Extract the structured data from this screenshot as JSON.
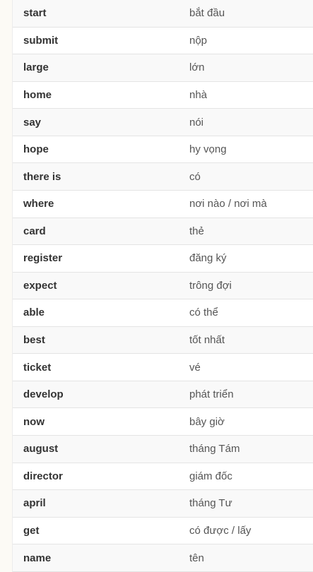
{
  "vocab": {
    "rows": [
      {
        "english": "start",
        "vietnamese": "bắt đầu"
      },
      {
        "english": "submit",
        "vietnamese": "nộp"
      },
      {
        "english": "large",
        "vietnamese": "lớn"
      },
      {
        "english": "home",
        "vietnamese": "nhà"
      },
      {
        "english": "say",
        "vietnamese": "nói"
      },
      {
        "english": "hope",
        "vietnamese": "hy vọng"
      },
      {
        "english": "there is",
        "vietnamese": "có"
      },
      {
        "english": "where",
        "vietnamese": "nơi nào / nơi mà"
      },
      {
        "english": "card",
        "vietnamese": "thẻ"
      },
      {
        "english": "register",
        "vietnamese": "đăng ký"
      },
      {
        "english": "expect",
        "vietnamese": "trông đợi"
      },
      {
        "english": "able",
        "vietnamese": "có thể"
      },
      {
        "english": "best",
        "vietnamese": "tốt nhất"
      },
      {
        "english": "ticket",
        "vietnamese": "vé"
      },
      {
        "english": "develop",
        "vietnamese": "phát triển"
      },
      {
        "english": "now",
        "vietnamese": "bây giờ"
      },
      {
        "english": "august",
        "vietnamese": "tháng Tám"
      },
      {
        "english": "director",
        "vietnamese": "giám đốc"
      },
      {
        "english": "april",
        "vietnamese": "tháng Tư"
      },
      {
        "english": "get",
        "vietnamese": "có được / lấy"
      },
      {
        "english": "name",
        "vietnamese": "tên"
      }
    ]
  }
}
